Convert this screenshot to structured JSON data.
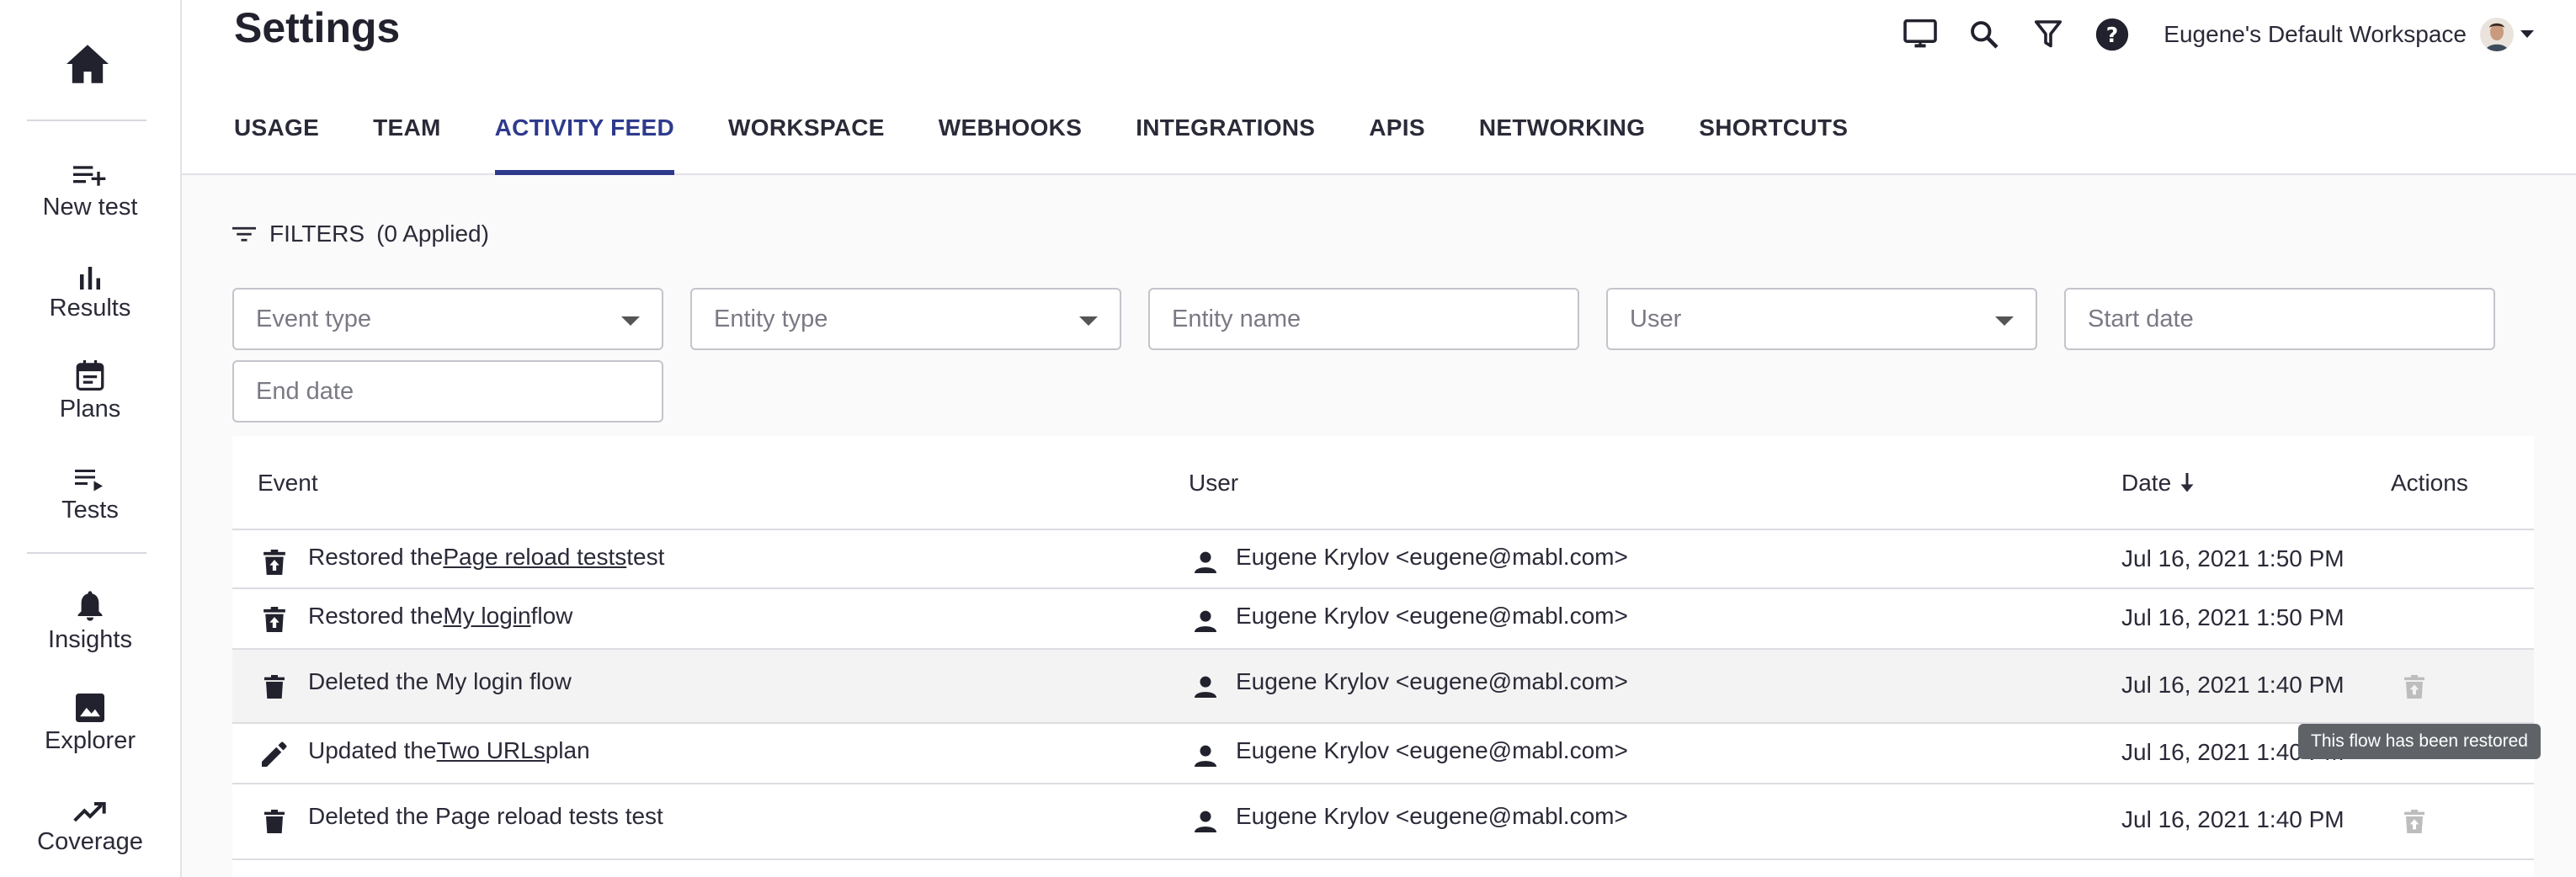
{
  "nav": {
    "items": [
      {
        "label": "New test",
        "icon": "playlist-add-icon"
      },
      {
        "label": "Results",
        "icon": "bar-chart-icon"
      },
      {
        "label": "Plans",
        "icon": "calendar-icon"
      },
      {
        "label": "Tests",
        "icon": "playlist-play-icon"
      },
      {
        "label": "Insights",
        "icon": "bell-icon"
      },
      {
        "label": "Explorer",
        "icon": "image-icon"
      },
      {
        "label": "Coverage",
        "icon": "trending-up-icon"
      }
    ]
  },
  "header": {
    "title": "Settings",
    "workspace": "Eugene's Default Workspace"
  },
  "tabs": [
    {
      "label": "USAGE"
    },
    {
      "label": "TEAM"
    },
    {
      "label": "ACTIVITY FEED",
      "active": true
    },
    {
      "label": "WORKSPACE"
    },
    {
      "label": "WEBHOOKS"
    },
    {
      "label": "INTEGRATIONS"
    },
    {
      "label": "APIS"
    },
    {
      "label": "NETWORKING"
    },
    {
      "label": "SHORTCUTS"
    }
  ],
  "filters": {
    "label": "FILTERS",
    "applied": "(0 Applied)",
    "event_type": "Event type",
    "entity_type": "Entity type",
    "entity_name": "Entity name",
    "user": "User",
    "start_date": "Start date",
    "end_date": "End date"
  },
  "table": {
    "headers": {
      "event": "Event",
      "user": "User",
      "date": "Date",
      "actions": "Actions"
    },
    "rows": [
      {
        "icon": "restore-icon",
        "pre": "Restored the ",
        "link": "Page reload tests",
        "post": " test",
        "user": "Eugene Krylov <eugene@mabl.com>",
        "date": "Jul 16, 2021 1:50 PM"
      },
      {
        "icon": "restore-icon",
        "pre": "Restored the ",
        "link": "My login",
        "post": " flow",
        "user": "Eugene Krylov <eugene@mabl.com>",
        "date": "Jul 16, 2021 1:50 PM"
      },
      {
        "icon": "delete-icon",
        "pre": "Deleted the My login flow",
        "link": "",
        "post": "",
        "user": "Eugene Krylov <eugene@mabl.com>",
        "date": "Jul 16, 2021 1:40 PM"
      },
      {
        "icon": "edit-icon",
        "pre": "Updated the ",
        "link": "Two URLs",
        "post": " plan",
        "user": "Eugene Krylov <eugene@mabl.com>",
        "date": "Jul 16, 2021 1:40 PM"
      },
      {
        "icon": "delete-icon",
        "pre": "Deleted the Page reload tests test",
        "link": "",
        "post": "",
        "user": "Eugene Krylov <eugene@mabl.com>",
        "date": "Jul 16, 2021 1:40 PM"
      }
    ]
  },
  "tooltip": "This flow has been restored",
  "colors": {
    "accent": "#2e3a8c",
    "disabled_icon": "#bdbdbd",
    "row_hover": "#f3f3f3"
  }
}
